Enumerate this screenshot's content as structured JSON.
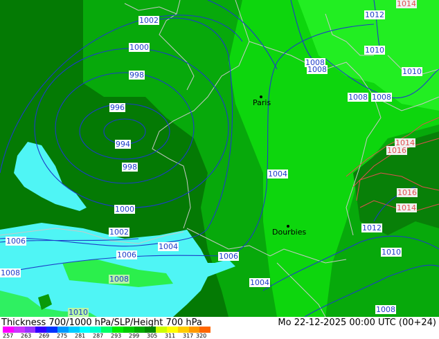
{
  "footer": {
    "title": "Thickness 700/1000 hPa/SLP/Height 700 hPa",
    "datetime": "Mo 22-12-2025 00:00 UTC (00+24)"
  },
  "cities": [
    {
      "name": "Paris"
    },
    {
      "name": "Dourbies"
    }
  ],
  "isobar_labels": [
    "1014",
    "1012",
    "1002",
    "1000",
    "1010",
    "1008",
    "1008",
    "1010",
    "998",
    "996",
    "1008",
    "1008",
    "994",
    "998",
    "1014",
    "1016",
    "1004",
    "1016",
    "1014",
    "1000",
    "1012",
    "1002",
    "1006",
    "1004",
    "1006",
    "1006",
    "1010",
    "1008",
    "1004",
    "1008",
    "1010",
    "1008"
  ],
  "scale": {
    "values": [
      "257",
      "263",
      "269",
      "275",
      "281",
      "287",
      "293",
      "299",
      "305",
      "311",
      "317",
      "320"
    ],
    "colors": [
      "#ff00ff",
      "#cc33ff",
      "#9933ff",
      "#3300ff",
      "#0033ff",
      "#0099ff",
      "#00ccff",
      "#00ffff",
      "#00ffcc",
      "#00ff66",
      "#00ee00",
      "#00cc00",
      "#00aa00",
      "#008800",
      "#ccff00",
      "#ffff00",
      "#ffcc00",
      "#ff9900",
      "#ff6600"
    ]
  },
  "colors": {
    "dark_green": "#047a04",
    "mid_green": "#07a90b",
    "bright_green": "#0dd60d",
    "light_green": "#22ee22",
    "cyan": "#4ff5f5",
    "isobar": "#1c3cc8",
    "red_contour": "#e05050",
    "border": "#c8c8c8"
  }
}
